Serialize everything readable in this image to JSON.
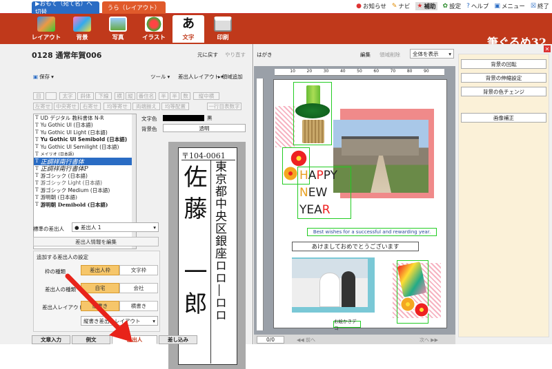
{
  "top": {
    "tab_front": "▶おもて（宛て名）へ切替",
    "tab_back": "うら（レイアウト）",
    "links": [
      {
        "icon": "bell-icon",
        "label": "お知らせ"
      },
      {
        "icon": "navi-icon",
        "label": "ナビ"
      },
      {
        "icon": "star-icon",
        "label": "補助"
      },
      {
        "icon": "gear-icon",
        "label": "設定"
      },
      {
        "icon": "help-icon",
        "label": "ヘルプ"
      },
      {
        "icon": "menu-icon",
        "label": "メニュー"
      },
      {
        "icon": "close-icon",
        "label": "終了"
      }
    ],
    "notify_badge": "1"
  },
  "ribbon": {
    "items": [
      "レイアウト",
      "背景",
      "写真",
      "イラスト",
      "文字",
      "印刷"
    ],
    "active": "文字",
    "brand": "筆ぐるめ32"
  },
  "left": {
    "doc_title": "0128 通常年賀006",
    "undo": "元に戻す",
    "redo": "やり直す",
    "save": "保存",
    "tool": "ツール",
    "sender_layout": "差出人レイアウト",
    "area_add": "領域追加",
    "fmt_row1": [
      "目",
      "",
      "太字",
      "斜体",
      "下線",
      "横",
      "縦",
      "番住名",
      "半",
      "半",
      "数",
      "縦中横"
    ],
    "fmt_row2": [
      "左寄せ",
      "中央寄せ",
      "右寄せ",
      "均等寄せ",
      "両端揃え",
      "均等配置",
      "一行目表数字"
    ],
    "fonts": [
      "UD デジタル 教科書体 N-R",
      "Yu Gothic UI (日本語)",
      "Yu Gothic UI Light (日本語)",
      "Yu Gothic UI Semibold (日本語)",
      "Yu Gothic UI Semilight (日本語)",
      "メイリオ (日本語)",
      "正調祥南行書体",
      "正調祥南行書体P",
      "游ゴシック (日本語)",
      "游ゴシック Light (日本語)",
      "游ゴシック Medium (日本語)",
      "游明朝 (日本語)",
      "游明朝 Demibold (日本語)"
    ],
    "selected_font": "正調祥南行書体",
    "text_color_label": "文字色",
    "text_color_value": "黒",
    "bg_color_label": "背景色",
    "bg_color_value": "透明",
    "std_sender_label": "標準の差出人",
    "std_sender_value": "● 差出人 1",
    "edit_sender_btn": "差出人情報を編集",
    "add_settings_label": "追加する差出人の設定",
    "frame_type_label": "枠の種類",
    "frame_opts": [
      "差出人枠",
      "文字枠"
    ],
    "sender_type_label": "差出人の種類",
    "sender_opts": [
      "自宅",
      "会社"
    ],
    "layout_label": "差出人レイアウト",
    "layout_opts": [
      "縦書き",
      "横書き"
    ],
    "layout_dd": "縦書き差出人レイアウト",
    "card": {
      "zip": "〒104-0061",
      "address": "東京都中央区銀座ロロ―ロロ",
      "name": "佐藤　一郎"
    },
    "bottom_tabs": [
      "文章入力",
      "例文",
      "差出人",
      "差し込み"
    ]
  },
  "main": {
    "label": "はがき",
    "edit": "編集",
    "area_delete": "領域削除",
    "view": "全体を表示",
    "happy": [
      "H",
      "A",
      "P",
      "P",
      "Y"
    ],
    "new": [
      "N",
      "E",
      "W"
    ],
    "year": [
      "Y",
      "E",
      "A",
      "R"
    ],
    "wishes": "Best wishes for a successful and rewarding year.",
    "greeting": "あけましておめでとうございます",
    "photo_caption": "お絵かきデコ",
    "page": "0/0",
    "prev": "前へ",
    "next": "次へ",
    "ruler": [
      "10",
      "20",
      "30",
      "40",
      "50",
      "60",
      "70",
      "80",
      "90"
    ]
  },
  "side": {
    "buttons": [
      "背景の回転",
      "背景の伸縮設定",
      "背景の色チェンジ",
      "画像補正"
    ]
  }
}
